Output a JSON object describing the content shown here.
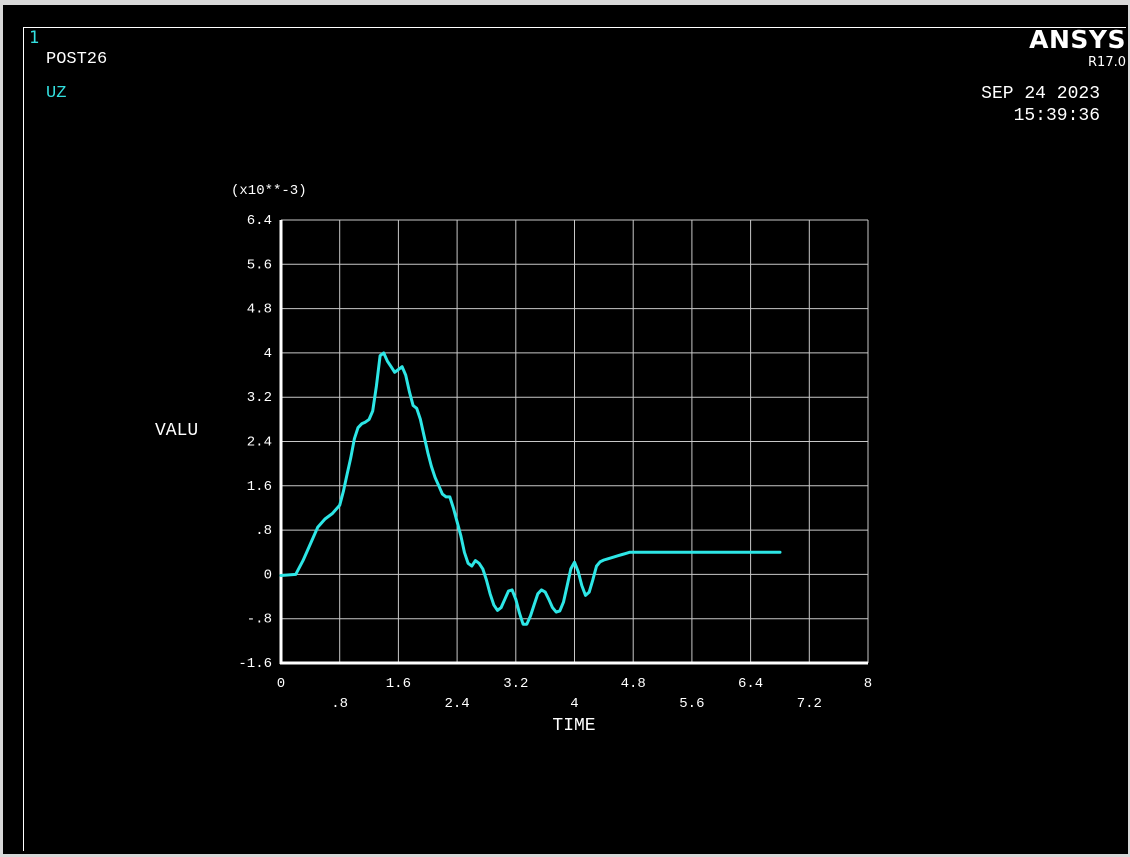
{
  "header": {
    "window_number": "1",
    "post_label": "POST26",
    "curve_label": "UZ",
    "brand": "ANSYS",
    "version": "R17.0",
    "date": "SEP 24 2023",
    "time": "15:39:36"
  },
  "colors": {
    "background": "#000000",
    "curve": "#2de6e6",
    "grid": "#c8c8c8",
    "text": "#ffffff",
    "label_accent": "#33e0e0"
  },
  "chart_data": {
    "type": "line",
    "title": "",
    "xlabel": "TIME",
    "ylabel": "VALU",
    "y_multiplier_label": "(x10**-3)",
    "xlim": [
      0,
      8
    ],
    "ylim": [
      -1.6,
      6.4
    ],
    "grid": true,
    "x_ticks": [
      0,
      0.8,
      1.6,
      2.4,
      3.2,
      4,
      4.8,
      5.6,
      6.4,
      7.2,
      8
    ],
    "x_tick_labels": [
      "0",
      ".8",
      "1.6",
      "2.4",
      "3.2",
      "4",
      "4.8",
      "5.6",
      "6.4",
      "7.2",
      "8"
    ],
    "y_ticks": [
      -1.6,
      -0.8,
      0,
      0.8,
      1.6,
      2.4,
      3.2,
      4,
      4.8,
      5.6,
      6.4
    ],
    "y_tick_labels": [
      "-1.6",
      "-.8",
      "0",
      ".8",
      "1.6",
      "2.4",
      "3.2",
      "4",
      "4.8",
      "5.6",
      "6.4"
    ],
    "series": [
      {
        "name": "UZ",
        "x": [
          0,
          0.2,
          0.3,
          0.4,
          0.5,
          0.6,
          0.7,
          0.8,
          0.85,
          0.9,
          0.95,
          1.0,
          1.05,
          1.1,
          1.15,
          1.2,
          1.25,
          1.3,
          1.35,
          1.4,
          1.45,
          1.5,
          1.55,
          1.6,
          1.65,
          1.7,
          1.75,
          1.8,
          1.85,
          1.9,
          1.95,
          2.0,
          2.05,
          2.1,
          2.15,
          2.2,
          2.25,
          2.3,
          2.35,
          2.4,
          2.45,
          2.5,
          2.55,
          2.6,
          2.65,
          2.7,
          2.75,
          2.8,
          2.85,
          2.9,
          2.95,
          3.0,
          3.05,
          3.1,
          3.15,
          3.2,
          3.25,
          3.3,
          3.35,
          3.4,
          3.45,
          3.5,
          3.55,
          3.6,
          3.65,
          3.7,
          3.75,
          3.8,
          3.85,
          3.9,
          3.95,
          4.0,
          4.05,
          4.1,
          4.15,
          4.2,
          4.25,
          4.3,
          4.35,
          4.4,
          4.45,
          4.5,
          4.55,
          4.6,
          4.65,
          4.7,
          4.75,
          4.8,
          4.85,
          4.9,
          4.95,
          5.0,
          5.05,
          5.1,
          5.5,
          6.0,
          6.5,
          6.8
        ],
        "values": [
          -0.02,
          0.0,
          0.25,
          0.55,
          0.85,
          1.0,
          1.1,
          1.25,
          1.5,
          1.8,
          2.1,
          2.45,
          2.65,
          2.72,
          2.75,
          2.8,
          2.95,
          3.4,
          3.95,
          4.0,
          3.85,
          3.75,
          3.65,
          3.7,
          3.75,
          3.6,
          3.3,
          3.05,
          3.0,
          2.8,
          2.5,
          2.2,
          1.95,
          1.75,
          1.6,
          1.45,
          1.4,
          1.4,
          1.2,
          0.95,
          0.7,
          0.4,
          0.2,
          0.15,
          0.25,
          0.2,
          0.1,
          -0.1,
          -0.35,
          -0.55,
          -0.65,
          -0.6,
          -0.45,
          -0.3,
          -0.28,
          -0.45,
          -0.7,
          -0.9,
          -0.9,
          -0.75,
          -0.55,
          -0.35,
          -0.28,
          -0.32,
          -0.45,
          -0.6,
          -0.68,
          -0.66,
          -0.5,
          -0.2,
          0.1,
          0.22,
          0.05,
          -0.2,
          -0.38,
          -0.32,
          -0.1,
          0.15,
          0.23,
          0.26,
          0.28,
          0.3,
          0.32,
          0.34,
          0.36,
          0.38,
          0.4,
          0.4,
          0.4,
          0.4,
          0.4,
          0.4,
          0.4,
          0.4,
          0.4,
          0.4,
          0.4,
          0.4
        ]
      }
    ]
  }
}
